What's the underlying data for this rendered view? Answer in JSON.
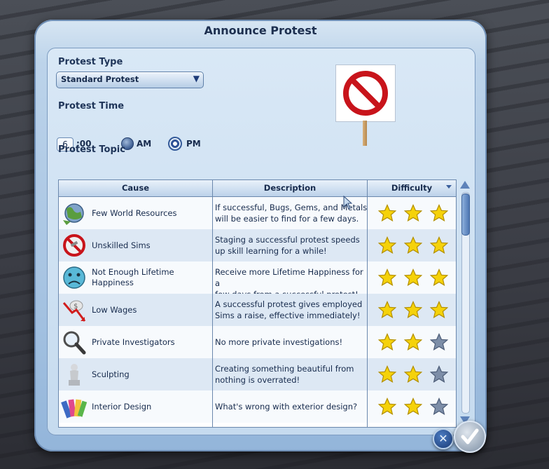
{
  "dialog": {
    "title": "Announce Protest",
    "protest_type_label": "Protest Type",
    "protest_type_value": "Standard Protest",
    "protest_time_label": "Protest Time",
    "hour_value": "6",
    "minute_suffix": ":00",
    "am_label": "AM",
    "pm_label": "PM",
    "selected_period": "PM",
    "protest_topic_label": "Protest Topic"
  },
  "table": {
    "headers": {
      "cause": "Cause",
      "description": "Description",
      "difficulty": "Difficulty"
    },
    "rows": [
      {
        "cause": "Few World Resources",
        "icon": "globe-icon",
        "description": [
          "If successful, Bugs, Gems, and Metals",
          "will be easier to find for a few days."
        ],
        "difficulty": 3
      },
      {
        "cause": "Unskilled Sims",
        "icon": "no-tools-icon",
        "description": [
          "Staging a successful protest speeds",
          "up skill learning for a while!"
        ],
        "difficulty": 3
      },
      {
        "cause": "Not Enough Lifetime Happiness",
        "cause_lines": [
          "Not Enough Lifetime",
          "Happiness"
        ],
        "icon": "sad-face-icon",
        "description": [
          "Receive more Lifetime Happiness for a",
          "few days from a successful protest!"
        ],
        "difficulty": 3
      },
      {
        "cause": "Low Wages",
        "icon": "falling-money-icon",
        "description": [
          "A successful protest gives employed",
          "Sims a raise, effective immediately!"
        ],
        "difficulty": 3
      },
      {
        "cause": "Private Investigators",
        "icon": "magnifier-icon",
        "description": [
          "No more private investigations!"
        ],
        "difficulty": 2
      },
      {
        "cause": "Sculpting",
        "icon": "statue-icon",
        "description": [
          "Creating something beautiful from",
          "nothing is overrated!"
        ],
        "difficulty": 2
      },
      {
        "cause": "Interior Design",
        "icon": "swatches-icon",
        "description": [
          "What's wrong with exterior design?"
        ],
        "difficulty": 2
      }
    ]
  },
  "colors": {
    "star_filled": "#f5d20a",
    "star_empty": "#7d8ea8",
    "accent": "#3a5f9c"
  }
}
